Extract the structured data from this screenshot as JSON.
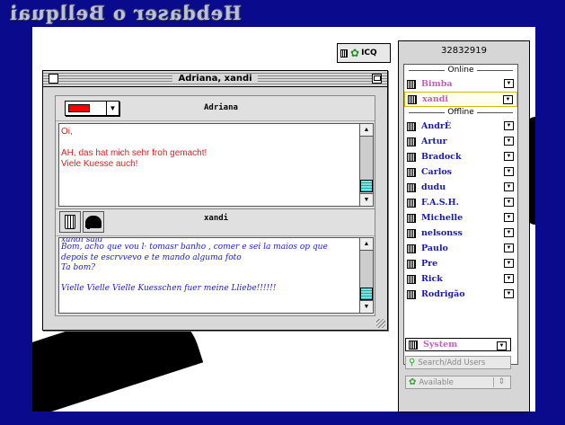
{
  "desktop": {
    "title": "Hebdaser o Bellquai"
  },
  "icq_button": {
    "label": "ICQ"
  },
  "chat_window": {
    "title": "Adriana, xandi",
    "incoming": {
      "name": "Adriana",
      "color": "#ff0000",
      "lines": [
        "Oi,",
        "",
        "AH, das hat mich sehr froh gemacht!",
        "Viele Kuesse auch!"
      ]
    },
    "outgoing": {
      "name": "xandi",
      "cut_line": "xandi said",
      "lines": [
        "Bom, acho que vou l· tomasr banho , comer e sei la maios op que",
        "depois te escrvvevo e te mando alguma foto",
        "Ta bom?",
        "",
        "Vielle Vielle Vielle Kuesschen fuer meine Lliebe!!!!!!"
      ]
    }
  },
  "contact_list": {
    "uin": "32832919",
    "online_header": "Online",
    "online": [
      "Bimba",
      "xandi"
    ],
    "offline_header": "Offline",
    "offline": [
      "AndrÈ",
      "Artur",
      "Bradock",
      "Carlos",
      "dudu",
      "F.A.S.H.",
      "Michelle",
      "nelsonss",
      "Paulo",
      "Pre",
      "Rick",
      "Rodrigão"
    ],
    "status_mode": "System",
    "search_label": "Search/Add Users",
    "availability": "Available"
  }
}
